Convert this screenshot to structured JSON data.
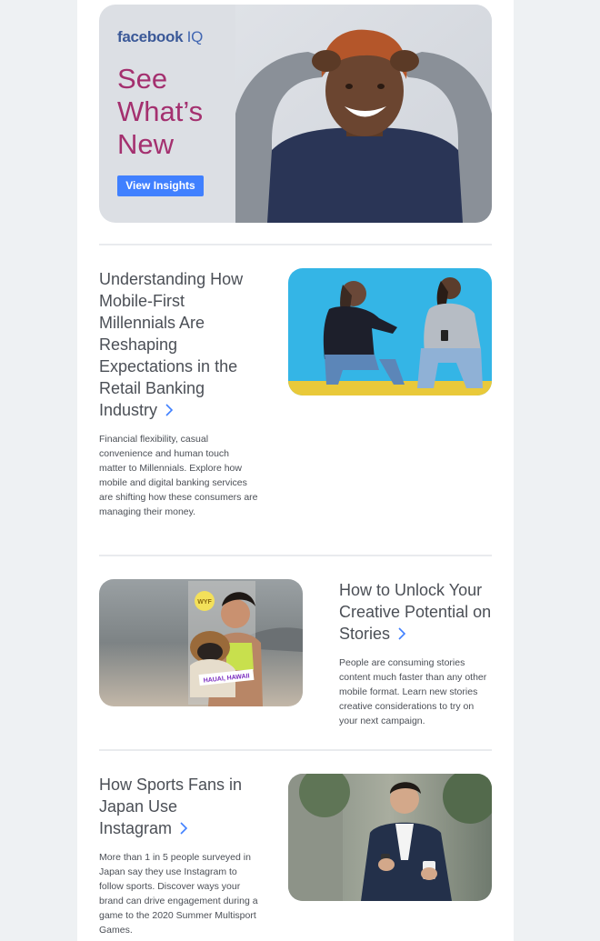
{
  "hero": {
    "brand": "facebook",
    "brand_suffix": "IQ",
    "title": "See What’s New",
    "button_label": "View Insights"
  },
  "articles": [
    {
      "title": "Understanding How Mobile-First Millennials Are Reshaping Expectations in the Retail Banking Industry",
      "body": "Financial flexibility, casual convenience and human touch matter to Millennials. Explore how mobile and digital banking services are shifting how these consumers are managing their money.",
      "image": "two-women-sitting-on-wall-photo"
    },
    {
      "title": "How to Unlock Your Creative Potential on Stories",
      "body": "People are consuming stories content much faster than any other mobile format. Learn new stories creative considerations to try on your next campaign.",
      "image": "woman-with-dog-story-photo",
      "sticker_1": "WYF",
      "sticker_2": "HAUAI, HAWAII"
    },
    {
      "title": "How Sports Fans in Japan Use Instagram",
      "body": "More than 1 in 5 people surveyed in Japan say they use Instagram to follow sports. Discover ways your brand can drive engagement during a game to the 2020 Summer Multisport Games.",
      "image": "man-with-phone-and-coffee-photo"
    }
  ],
  "colors": {
    "accent": "#a4306f",
    "button": "#4080ff",
    "brand": "#3b5998",
    "chevron": "#4080ff"
  }
}
